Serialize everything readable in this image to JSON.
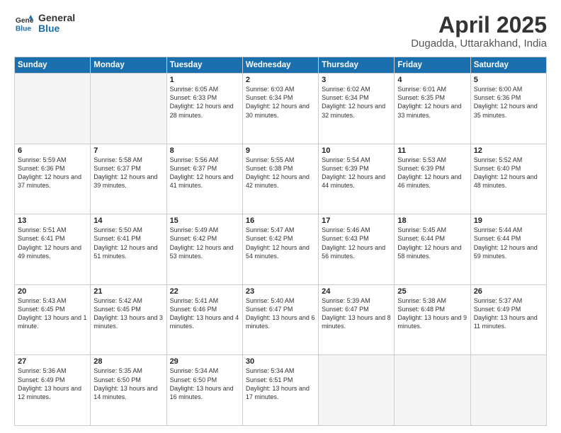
{
  "logo": {
    "line1": "General",
    "line2": "Blue"
  },
  "title": "April 2025",
  "location": "Dugadda, Uttarakhand, India",
  "headers": [
    "Sunday",
    "Monday",
    "Tuesday",
    "Wednesday",
    "Thursday",
    "Friday",
    "Saturday"
  ],
  "weeks": [
    [
      {
        "day": "",
        "sunrise": "",
        "sunset": "",
        "daylight": ""
      },
      {
        "day": "",
        "sunrise": "",
        "sunset": "",
        "daylight": ""
      },
      {
        "day": "1",
        "sunrise": "Sunrise: 6:05 AM",
        "sunset": "Sunset: 6:33 PM",
        "daylight": "Daylight: 12 hours and 28 minutes."
      },
      {
        "day": "2",
        "sunrise": "Sunrise: 6:03 AM",
        "sunset": "Sunset: 6:34 PM",
        "daylight": "Daylight: 12 hours and 30 minutes."
      },
      {
        "day": "3",
        "sunrise": "Sunrise: 6:02 AM",
        "sunset": "Sunset: 6:34 PM",
        "daylight": "Daylight: 12 hours and 32 minutes."
      },
      {
        "day": "4",
        "sunrise": "Sunrise: 6:01 AM",
        "sunset": "Sunset: 6:35 PM",
        "daylight": "Daylight: 12 hours and 33 minutes."
      },
      {
        "day": "5",
        "sunrise": "Sunrise: 6:00 AM",
        "sunset": "Sunset: 6:36 PM",
        "daylight": "Daylight: 12 hours and 35 minutes."
      }
    ],
    [
      {
        "day": "6",
        "sunrise": "Sunrise: 5:59 AM",
        "sunset": "Sunset: 6:36 PM",
        "daylight": "Daylight: 12 hours and 37 minutes."
      },
      {
        "day": "7",
        "sunrise": "Sunrise: 5:58 AM",
        "sunset": "Sunset: 6:37 PM",
        "daylight": "Daylight: 12 hours and 39 minutes."
      },
      {
        "day": "8",
        "sunrise": "Sunrise: 5:56 AM",
        "sunset": "Sunset: 6:37 PM",
        "daylight": "Daylight: 12 hours and 41 minutes."
      },
      {
        "day": "9",
        "sunrise": "Sunrise: 5:55 AM",
        "sunset": "Sunset: 6:38 PM",
        "daylight": "Daylight: 12 hours and 42 minutes."
      },
      {
        "day": "10",
        "sunrise": "Sunrise: 5:54 AM",
        "sunset": "Sunset: 6:39 PM",
        "daylight": "Daylight: 12 hours and 44 minutes."
      },
      {
        "day": "11",
        "sunrise": "Sunrise: 5:53 AM",
        "sunset": "Sunset: 6:39 PM",
        "daylight": "Daylight: 12 hours and 46 minutes."
      },
      {
        "day": "12",
        "sunrise": "Sunrise: 5:52 AM",
        "sunset": "Sunset: 6:40 PM",
        "daylight": "Daylight: 12 hours and 48 minutes."
      }
    ],
    [
      {
        "day": "13",
        "sunrise": "Sunrise: 5:51 AM",
        "sunset": "Sunset: 6:41 PM",
        "daylight": "Daylight: 12 hours and 49 minutes."
      },
      {
        "day": "14",
        "sunrise": "Sunrise: 5:50 AM",
        "sunset": "Sunset: 6:41 PM",
        "daylight": "Daylight: 12 hours and 51 minutes."
      },
      {
        "day": "15",
        "sunrise": "Sunrise: 5:49 AM",
        "sunset": "Sunset: 6:42 PM",
        "daylight": "Daylight: 12 hours and 53 minutes."
      },
      {
        "day": "16",
        "sunrise": "Sunrise: 5:47 AM",
        "sunset": "Sunset: 6:42 PM",
        "daylight": "Daylight: 12 hours and 54 minutes."
      },
      {
        "day": "17",
        "sunrise": "Sunrise: 5:46 AM",
        "sunset": "Sunset: 6:43 PM",
        "daylight": "Daylight: 12 hours and 56 minutes."
      },
      {
        "day": "18",
        "sunrise": "Sunrise: 5:45 AM",
        "sunset": "Sunset: 6:44 PM",
        "daylight": "Daylight: 12 hours and 58 minutes."
      },
      {
        "day": "19",
        "sunrise": "Sunrise: 5:44 AM",
        "sunset": "Sunset: 6:44 PM",
        "daylight": "Daylight: 12 hours and 59 minutes."
      }
    ],
    [
      {
        "day": "20",
        "sunrise": "Sunrise: 5:43 AM",
        "sunset": "Sunset: 6:45 PM",
        "daylight": "Daylight: 13 hours and 1 minute."
      },
      {
        "day": "21",
        "sunrise": "Sunrise: 5:42 AM",
        "sunset": "Sunset: 6:45 PM",
        "daylight": "Daylight: 13 hours and 3 minutes."
      },
      {
        "day": "22",
        "sunrise": "Sunrise: 5:41 AM",
        "sunset": "Sunset: 6:46 PM",
        "daylight": "Daylight: 13 hours and 4 minutes."
      },
      {
        "day": "23",
        "sunrise": "Sunrise: 5:40 AM",
        "sunset": "Sunset: 6:47 PM",
        "daylight": "Daylight: 13 hours and 6 minutes."
      },
      {
        "day": "24",
        "sunrise": "Sunrise: 5:39 AM",
        "sunset": "Sunset: 6:47 PM",
        "daylight": "Daylight: 13 hours and 8 minutes."
      },
      {
        "day": "25",
        "sunrise": "Sunrise: 5:38 AM",
        "sunset": "Sunset: 6:48 PM",
        "daylight": "Daylight: 13 hours and 9 minutes."
      },
      {
        "day": "26",
        "sunrise": "Sunrise: 5:37 AM",
        "sunset": "Sunset: 6:49 PM",
        "daylight": "Daylight: 13 hours and 11 minutes."
      }
    ],
    [
      {
        "day": "27",
        "sunrise": "Sunrise: 5:36 AM",
        "sunset": "Sunset: 6:49 PM",
        "daylight": "Daylight: 13 hours and 12 minutes."
      },
      {
        "day": "28",
        "sunrise": "Sunrise: 5:35 AM",
        "sunset": "Sunset: 6:50 PM",
        "daylight": "Daylight: 13 hours and 14 minutes."
      },
      {
        "day": "29",
        "sunrise": "Sunrise: 5:34 AM",
        "sunset": "Sunset: 6:50 PM",
        "daylight": "Daylight: 13 hours and 16 minutes."
      },
      {
        "day": "30",
        "sunrise": "Sunrise: 5:34 AM",
        "sunset": "Sunset: 6:51 PM",
        "daylight": "Daylight: 13 hours and 17 minutes."
      },
      {
        "day": "",
        "sunrise": "",
        "sunset": "",
        "daylight": ""
      },
      {
        "day": "",
        "sunrise": "",
        "sunset": "",
        "daylight": ""
      },
      {
        "day": "",
        "sunrise": "",
        "sunset": "",
        "daylight": ""
      }
    ]
  ]
}
